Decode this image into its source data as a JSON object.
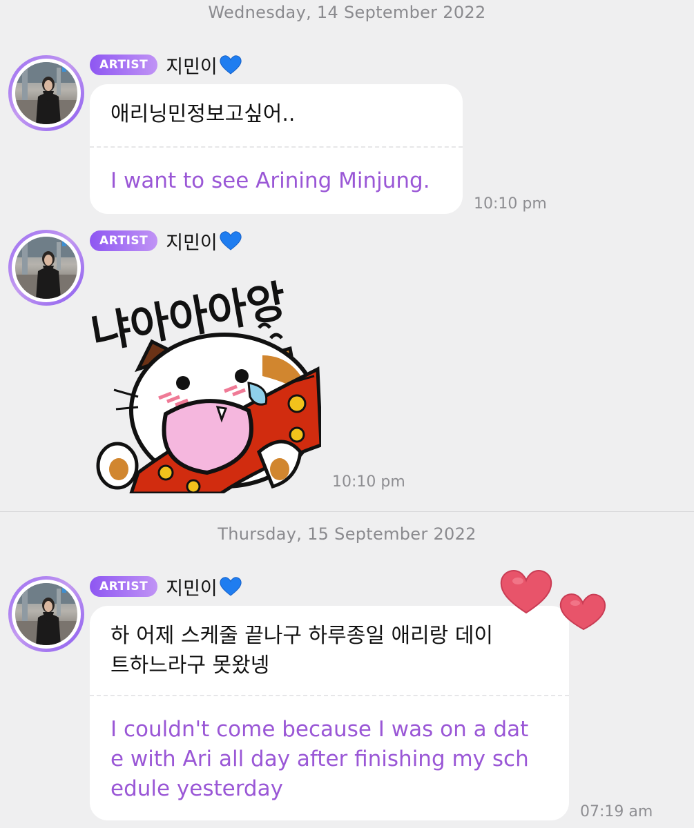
{
  "chat": {
    "date_1": "Wednesday, 14 September 2022",
    "date_2": "Thursday, 15 September 2022",
    "messages": [
      {
        "badge": "ARTIST",
        "sender": "지민이",
        "icon": "blue-heart-icon",
        "korean": "애리닝민정보고싶어..",
        "english": "I want to see Arining Minjung.",
        "time": "10:10 pm"
      },
      {
        "badge": "ARTIST",
        "sender": "지민이",
        "icon": "blue-heart-icon",
        "sticker_text": "냐아아아앙",
        "sticker_icon": "crying-cat-sticker",
        "time": "10:10 pm"
      },
      {
        "badge": "ARTIST",
        "sender": "지민이",
        "icon": "blue-heart-icon",
        "korean_line_1": "하 어제 스케줄 끝나구 하루종일 애리랑 데이",
        "korean_line_2": "트하느라구 못왔넹",
        "english_line_1": "I couldn't come because I was on a dat",
        "english_line_2": "e with Ari all day after finishing my sch",
        "english_line_3": "edule yesterday",
        "time": "07:19 am",
        "reaction_icon": "red-hearts-icon"
      }
    ]
  },
  "colors": {
    "background": "#efeff0",
    "bubble": "#ffffff",
    "translation": "#9a57d6",
    "badge_start": "#8e57f2",
    "badge_end": "#c093f5",
    "heart_blue": "#1f7df0",
    "heart_red": "#e8546a"
  }
}
